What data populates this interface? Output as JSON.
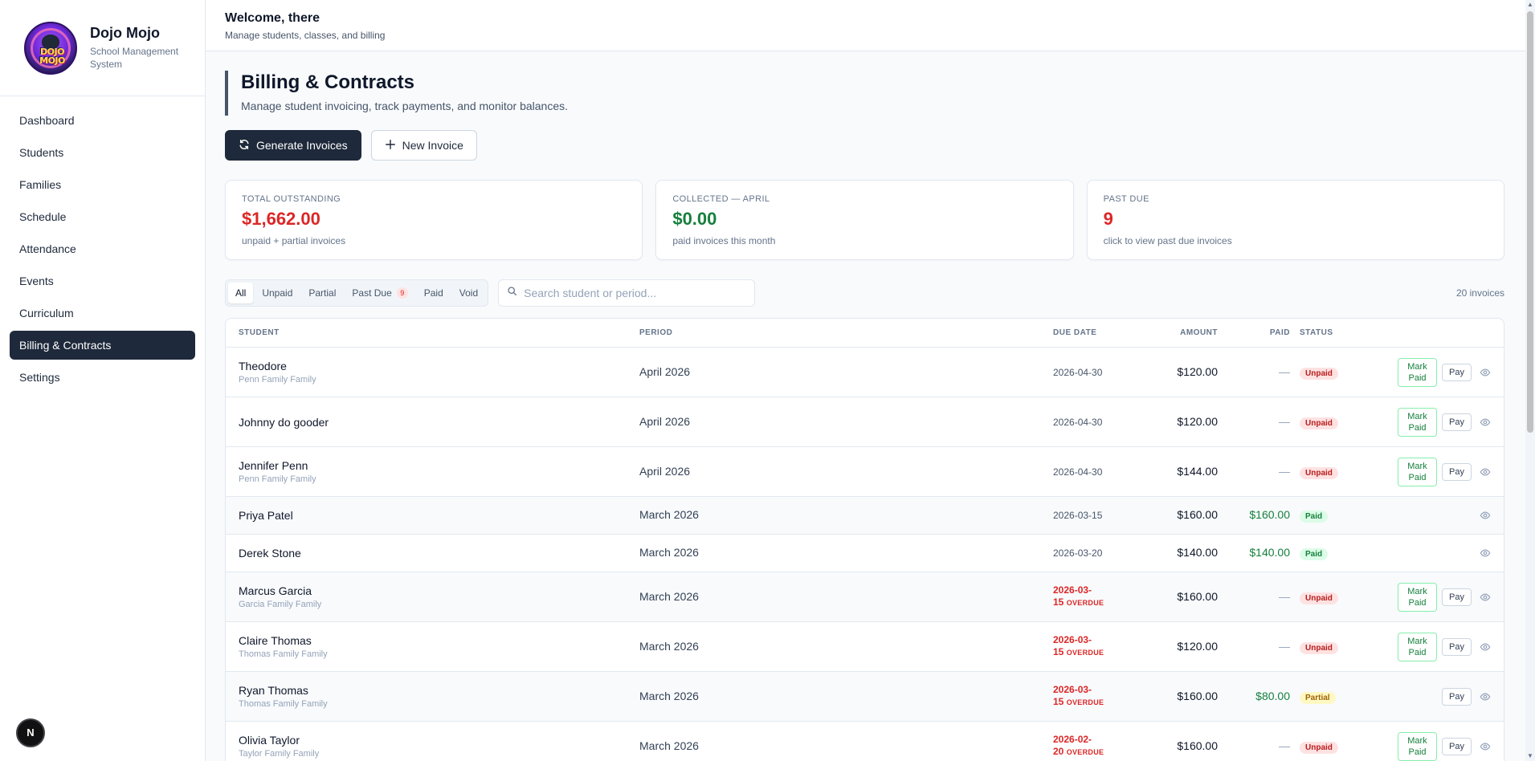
{
  "brand": {
    "name": "Dojo Mojo",
    "subtitle": "School Management System",
    "logo_text": "DOJO MOJO"
  },
  "nav": [
    {
      "label": "Dashboard",
      "active": false
    },
    {
      "label": "Students",
      "active": false
    },
    {
      "label": "Families",
      "active": false
    },
    {
      "label": "Schedule",
      "active": false
    },
    {
      "label": "Attendance",
      "active": false
    },
    {
      "label": "Events",
      "active": false
    },
    {
      "label": "Curriculum",
      "active": false
    },
    {
      "label": "Billing & Contracts",
      "active": true
    },
    {
      "label": "Settings",
      "active": false
    }
  ],
  "floating_badge": "N",
  "topbar": {
    "welcome": "Welcome, there",
    "subtitle": "Manage students, classes, and billing"
  },
  "page": {
    "title": "Billing & Contracts",
    "subtitle": "Manage student invoicing, track payments, and monitor balances."
  },
  "actions": {
    "generate_label": "Generate Invoices",
    "new_label": "New Invoice"
  },
  "cards": [
    {
      "label": "TOTAL OUTSTANDING",
      "value": "$1,662.00",
      "note": "unpaid + partial invoices",
      "color": "#dc2626"
    },
    {
      "label": "COLLECTED — APRIL",
      "value": "$0.00",
      "note": "paid invoices this month",
      "color": "#15803d"
    },
    {
      "label": "PAST DUE",
      "value": "9",
      "note": "click to view past due invoices",
      "color": "#dc2626"
    }
  ],
  "filters": {
    "tabs": [
      {
        "label": "All",
        "active": true
      },
      {
        "label": "Unpaid",
        "active": false
      },
      {
        "label": "Partial",
        "active": false
      },
      {
        "label": "Past Due",
        "active": false,
        "badge": "9"
      },
      {
        "label": "Paid",
        "active": false
      },
      {
        "label": "Void",
        "active": false
      }
    ],
    "search_placeholder": "Search student or period...",
    "invoice_count": "20 invoices"
  },
  "table": {
    "columns": {
      "student": "STUDENT",
      "period": "PERIOD",
      "due": "DUE DATE",
      "amount": "AMOUNT",
      "paid": "PAID",
      "status": "STATUS"
    },
    "mark_paid_line1": "Mark",
    "mark_paid_line2": "Paid",
    "pay_label": "Pay",
    "overdue_label": "OVERDUE",
    "rows": [
      {
        "student": "Theodore",
        "family": "Penn Family Family",
        "period": "April 2026",
        "due": "2026-04-30",
        "overdue": false,
        "amount": "$120.00",
        "paid": "—",
        "status": "Unpaid",
        "mark_paid": true,
        "pay": true
      },
      {
        "student": "Johnny do gooder",
        "family": "",
        "period": "April 2026",
        "due": "2026-04-30",
        "overdue": false,
        "amount": "$120.00",
        "paid": "—",
        "status": "Unpaid",
        "mark_paid": true,
        "pay": true
      },
      {
        "student": "Jennifer Penn",
        "family": "Penn Family Family",
        "period": "April 2026",
        "due": "2026-04-30",
        "overdue": false,
        "amount": "$144.00",
        "paid": "—",
        "status": "Unpaid",
        "mark_paid": true,
        "pay": true
      },
      {
        "student": "Priya Patel",
        "family": "",
        "period": "March 2026",
        "due": "2026-03-15",
        "overdue": false,
        "amount": "$160.00",
        "paid": "$160.00",
        "status": "Paid",
        "mark_paid": false,
        "pay": false
      },
      {
        "student": "Derek Stone",
        "family": "",
        "period": "March 2026",
        "due": "2026-03-20",
        "overdue": false,
        "amount": "$140.00",
        "paid": "$140.00",
        "status": "Paid",
        "mark_paid": false,
        "pay": false
      },
      {
        "student": "Marcus Garcia",
        "family": "Garcia Family Family",
        "period": "March 2026",
        "due_line1": "2026-03-",
        "due_line2": "15",
        "overdue": true,
        "amount": "$160.00",
        "paid": "—",
        "status": "Unpaid",
        "mark_paid": true,
        "pay": true
      },
      {
        "student": "Claire Thomas",
        "family": "Thomas Family Family",
        "period": "March 2026",
        "due_line1": "2026-03-",
        "due_line2": "15",
        "overdue": true,
        "amount": "$120.00",
        "paid": "—",
        "status": "Unpaid",
        "mark_paid": true,
        "pay": true
      },
      {
        "student": "Ryan Thomas",
        "family": "Thomas Family Family",
        "period": "March 2026",
        "due_line1": "2026-03-",
        "due_line2": "15",
        "overdue": true,
        "amount": "$160.00",
        "paid": "$80.00",
        "status": "Partial",
        "mark_paid": false,
        "pay": true
      },
      {
        "student": "Olivia Taylor",
        "family": "Taylor Family Family",
        "period": "March 2026",
        "due_line1": "2026-02-",
        "due_line2": "20",
        "overdue": true,
        "amount": "$160.00",
        "paid": "—",
        "status": "Unpaid",
        "mark_paid": true,
        "pay": true
      }
    ]
  }
}
